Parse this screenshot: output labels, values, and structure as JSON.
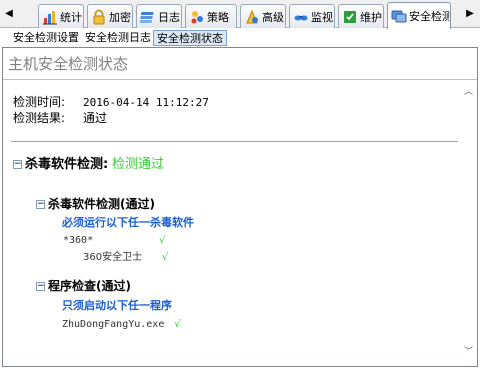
{
  "tabs": [
    {
      "label": "统计",
      "icon": "bar-chart-icon"
    },
    {
      "label": "加密",
      "icon": "lock-icon"
    },
    {
      "label": "日志",
      "icon": "log-icon"
    },
    {
      "label": "策略",
      "icon": "policy-icon"
    },
    {
      "label": "高级",
      "icon": "advanced-icon"
    },
    {
      "label": "监视",
      "icon": "monitor-icon"
    },
    {
      "label": "维护",
      "icon": "maintenance-icon"
    },
    {
      "label": "安全检测",
      "icon": "security-check-icon",
      "active": true
    }
  ],
  "subtabs": [
    {
      "label": "安全检测设置"
    },
    {
      "label": "安全检测日志"
    },
    {
      "label": "安全检测状态",
      "active": true
    }
  ],
  "page": {
    "title": "主机安全检测状态",
    "check_time_label": "检测时间:",
    "check_time_value": "2016-04-14 11:12:27",
    "check_result_label": "检测结果:",
    "check_result_value": "通过"
  },
  "antivirus": {
    "heading": "杀毒软件检测:",
    "status": "检测通过",
    "sub_heading": "杀毒软件检测(通过)",
    "requirement": "必须运行以下任一杀毒软件",
    "group": "*360*",
    "item": "360安全卫士",
    "item_check": "√"
  },
  "program": {
    "heading": "程序检查(通过)",
    "requirement": "只须启动以下任一程序",
    "item": "ZhuDongFangYu.exe",
    "item_check": "√"
  },
  "colors": {
    "pass_green": "#33cc33",
    "requirement_blue": "#1a5fd6",
    "title_gray": "#808080"
  }
}
